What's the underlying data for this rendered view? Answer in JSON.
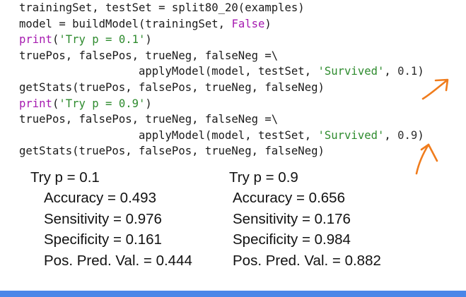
{
  "code": {
    "lines": [
      {
        "segments": [
          {
            "text": "trainingSet, testSet = split80_20(examples)",
            "cls": ""
          }
        ]
      },
      {
        "segments": [
          {
            "text": "model = buildModel(trainingSet, ",
            "cls": ""
          },
          {
            "text": "False",
            "cls": "tok-kw"
          },
          {
            "text": ")",
            "cls": ""
          }
        ]
      },
      {
        "segments": [
          {
            "text": "print",
            "cls": "tok-kw"
          },
          {
            "text": "(",
            "cls": ""
          },
          {
            "text": "'Try p = 0.1'",
            "cls": "tok-str"
          },
          {
            "text": ")",
            "cls": ""
          }
        ]
      },
      {
        "segments": [
          {
            "text": "truePos, falsePos, trueNeg, falseNeg =\\",
            "cls": ""
          }
        ]
      },
      {
        "segments": [
          {
            "text": "                  applyModel(model, testSet, ",
            "cls": ""
          },
          {
            "text": "'Survived'",
            "cls": "tok-str"
          },
          {
            "text": ", ",
            "cls": ""
          },
          {
            "text": "0.1",
            "cls": "tok-num"
          },
          {
            "text": ")",
            "cls": ""
          }
        ]
      },
      {
        "segments": [
          {
            "text": "getStats(truePos, falsePos, trueNeg, falseNeg)",
            "cls": ""
          }
        ]
      },
      {
        "segments": [
          {
            "text": "print",
            "cls": "tok-kw"
          },
          {
            "text": "(",
            "cls": ""
          },
          {
            "text": "'Try p = 0.9'",
            "cls": "tok-str"
          },
          {
            "text": ")",
            "cls": ""
          }
        ]
      },
      {
        "segments": [
          {
            "text": "truePos, falsePos, trueNeg, falseNeg =\\",
            "cls": ""
          }
        ]
      },
      {
        "segments": [
          {
            "text": "                  applyModel(model, testSet, ",
            "cls": ""
          },
          {
            "text": "'Survived'",
            "cls": "tok-str"
          },
          {
            "text": ", ",
            "cls": ""
          },
          {
            "text": "0.9",
            "cls": "tok-num"
          },
          {
            "text": ")",
            "cls": ""
          }
        ]
      },
      {
        "segments": [
          {
            "text": "getStats(truePos, falsePos, trueNeg, falseNeg)",
            "cls": ""
          }
        ]
      }
    ]
  },
  "results": {
    "left": {
      "title": "Try p = 0.1",
      "accuracy": "Accuracy = 0.493",
      "sensitivity": "Sensitivity = 0.976",
      "specificity": "Specificity = 0.161",
      "ppv": "Pos. Pred. Val. = 0.444"
    },
    "right": {
      "title": "Try p = 0.9",
      "accuracy": "Accuracy = 0.656",
      "sensitivity": "Sensitivity = 0.176",
      "specificity": "Specificity = 0.984",
      "ppv": "Pos. Pred. Val. = 0.882"
    }
  },
  "colors": {
    "keyword": "#a61bb0",
    "string": "#2e8b2e",
    "annotation": "#f07c1c",
    "bottom_bar": "#4a86e8"
  },
  "icons": {
    "annotation_1": "hand-drawn-arrow-icon",
    "annotation_2": "hand-drawn-arrow-icon"
  }
}
